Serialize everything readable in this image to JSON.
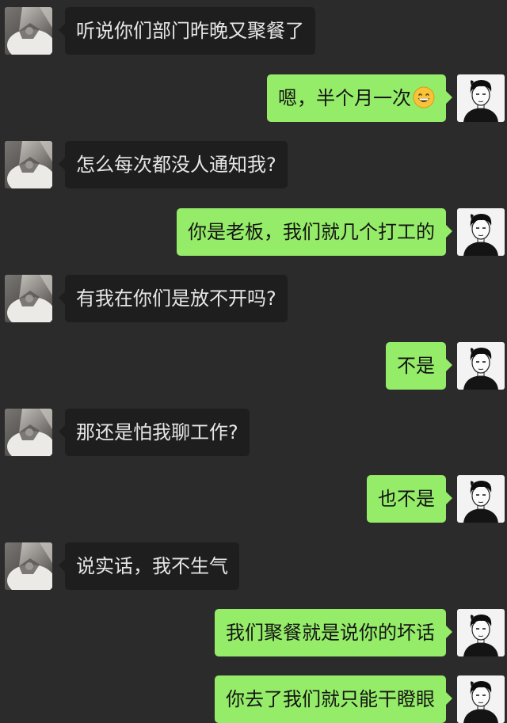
{
  "chat": {
    "colors": {
      "background": "#2b2b2b",
      "incoming_bubble": "#1e1e1e",
      "outgoing_bubble": "#95ec69"
    },
    "messages": [
      {
        "side": "left",
        "text": "听说你们部门昨晚又聚餐了"
      },
      {
        "side": "right",
        "text": "嗯，半个月一次",
        "emoji": "grinning-face-emoji"
      },
      {
        "side": "left",
        "text": "怎么每次都没人通知我?"
      },
      {
        "side": "right",
        "text": "你是老板，我们就几个打工的"
      },
      {
        "side": "left",
        "text": "有我在你们是放不开吗?"
      },
      {
        "side": "right",
        "text": "不是"
      },
      {
        "side": "left",
        "text": "那还是怕我聊工作?"
      },
      {
        "side": "right",
        "text": "也不是"
      },
      {
        "side": "left",
        "text": "说实话，我不生气"
      },
      {
        "side": "right",
        "text": "我们聚餐就是说你的坏话"
      },
      {
        "side": "right",
        "text": "你去了我们就只能干瞪眼"
      }
    ]
  }
}
